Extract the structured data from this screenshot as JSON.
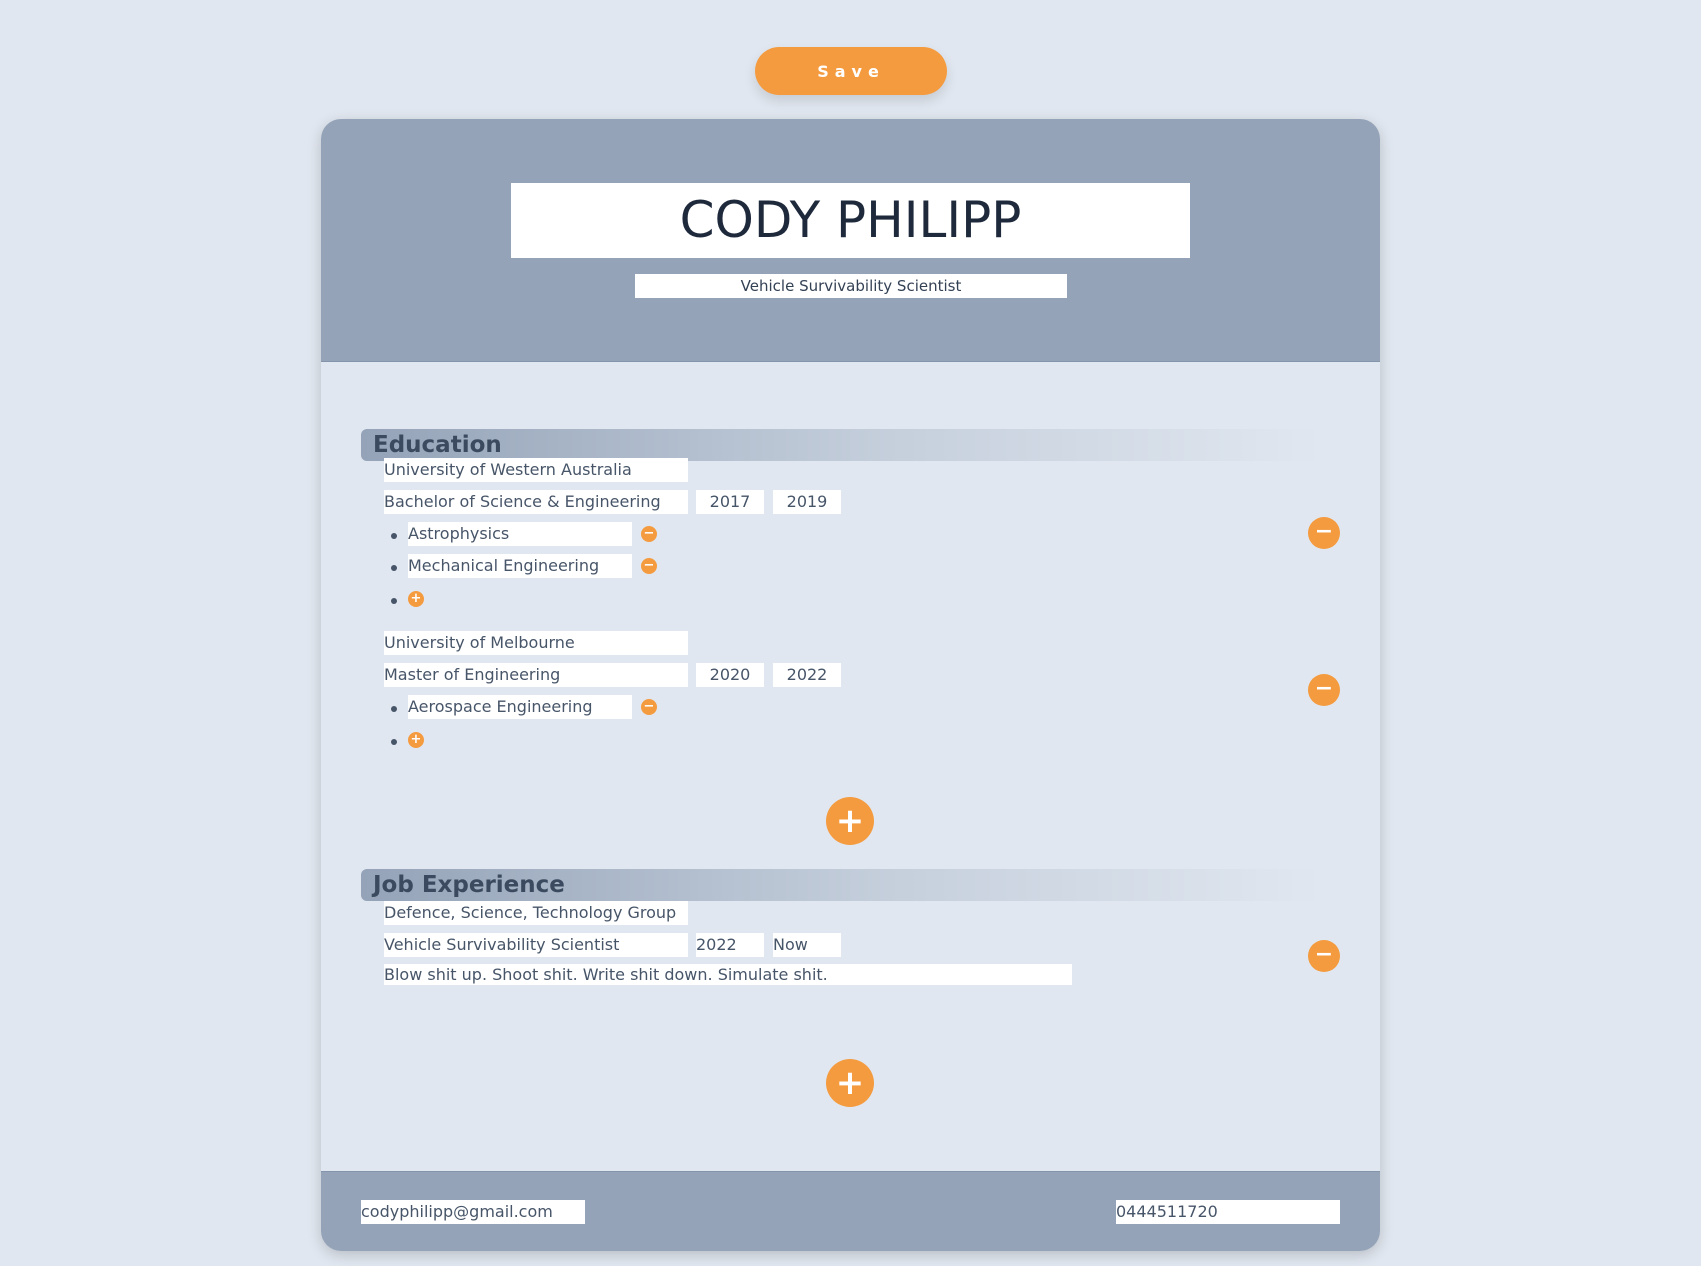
{
  "toolbar": {
    "save_label": "Save"
  },
  "header": {
    "name": "CODY PHILIPP",
    "title": "Vehicle Survivability Scientist"
  },
  "education": {
    "heading": "Education",
    "entries": [
      {
        "institution": "University of Western Australia",
        "degree": "Bachelor of Science & Engineering",
        "start": "2017",
        "end": "2019",
        "majors": [
          "Astrophysics",
          "Mechanical Engineering"
        ]
      },
      {
        "institution": "University of Melbourne",
        "degree": "Master of Engineering",
        "start": "2020",
        "end": "2022",
        "majors": [
          "Aerospace Engineering"
        ]
      }
    ]
  },
  "jobs": {
    "heading": "Job Experience",
    "entries": [
      {
        "company": "Defence, Science, Technology Group",
        "role": "Vehicle Survivability Scientist",
        "start": "2022",
        "end": "Now",
        "description": "Blow shit up. Shoot shit. Write shit down. Simulate shit."
      }
    ]
  },
  "footer": {
    "email": "codyphilipp@gmail.com",
    "phone": "0444511720"
  },
  "icons": {
    "add": "plus-icon",
    "remove": "minus-icon"
  },
  "colors": {
    "accent": "#f49b3f",
    "header_bg": "#94a3b8",
    "page_bg": "#e1e7f0"
  }
}
